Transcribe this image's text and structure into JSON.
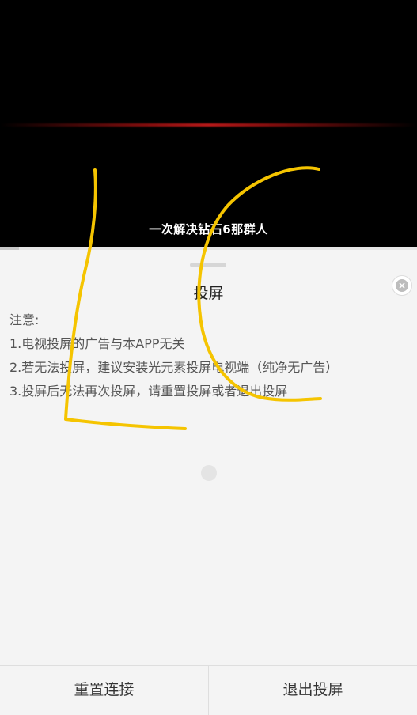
{
  "video": {
    "subtitle": "一次解决钻石6那群人",
    "progress_fraction": 0.045
  },
  "sheet": {
    "title": "投屏",
    "close_icon": "close-circle-icon",
    "notes_label": "注意:",
    "notes": [
      "1.电视投屏的广告与本APP无关",
      "2.若无法投屏，建议安装光元素投屏电视端（纯净无广告）",
      "3.投屏后无法再次投屏，请重置投屏或者退出投屏"
    ]
  },
  "footer": {
    "reset_label": "重置连接",
    "exit_label": "退出投屏"
  },
  "colors": {
    "annotation": "#f5c400",
    "video_bg": "#000000",
    "sheet_bg": "#f4f4f4"
  }
}
